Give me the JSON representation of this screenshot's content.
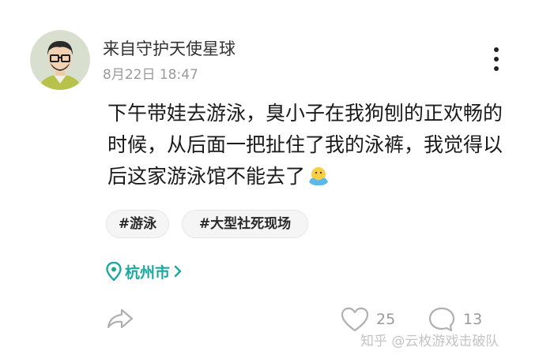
{
  "post": {
    "author": "来自守护天使星球",
    "timestamp": "8月22日 18:47",
    "content_lines": [
      "下午带娃去游泳，臭小子在我狗刨的正欢畅的",
      "时候，从后面一把扯住了我的泳裤，我觉得以",
      "后这家游泳馆不能去了"
    ],
    "tags": [
      "#游泳",
      "#大型社死现场"
    ],
    "location": "杭州市",
    "likes": "25",
    "comments": "13"
  },
  "watermark": "知乎 @云枚游戏击破队",
  "colors": {
    "location_accent": "#1aa8a0",
    "tag_bg": "#f5f5f5",
    "muted_text": "#9a9a9a"
  },
  "icons": {
    "more": "more-vertical-icon",
    "location": "location-pin-icon",
    "share": "share-icon",
    "like": "heart-icon",
    "comment": "comment-icon"
  }
}
